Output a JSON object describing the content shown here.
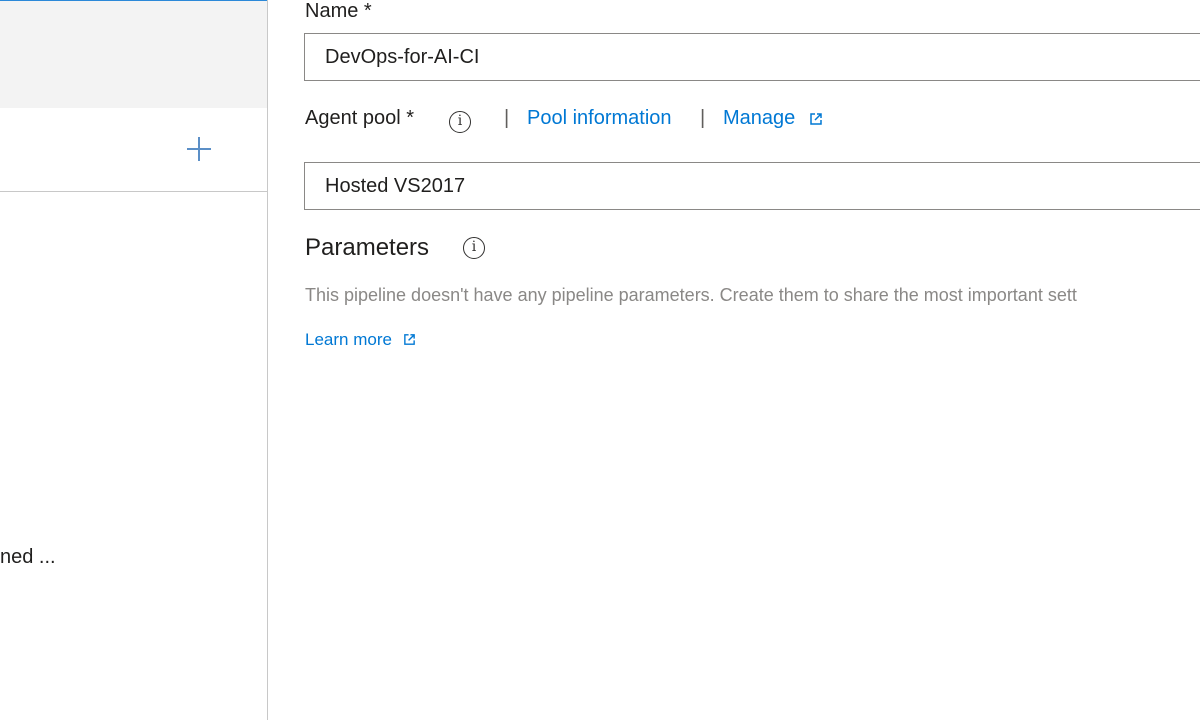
{
  "left": {
    "truncated_item_text": "ned ...",
    "add_icon": "plus-icon"
  },
  "form": {
    "name": {
      "label": "Name *",
      "value": "DevOps-for-AI-CI"
    },
    "agent_pool": {
      "label": "Agent pool *",
      "info_icon": "info-icon",
      "separator": "|",
      "pool_info_link": "Pool information",
      "manage_link": "Manage",
      "external_icon": "external-link-icon",
      "value": "Hosted VS2017"
    },
    "parameters": {
      "title": "Parameters",
      "info_icon": "info-icon",
      "description": "This pipeline doesn't have any pipeline parameters. Create them to share the most important sett",
      "learn_more": "Learn more"
    }
  },
  "colors": {
    "link": "#0078d4",
    "border": "#8a8886",
    "selected_bg": "#f3f3f3",
    "muted_text": "#8a8886"
  }
}
